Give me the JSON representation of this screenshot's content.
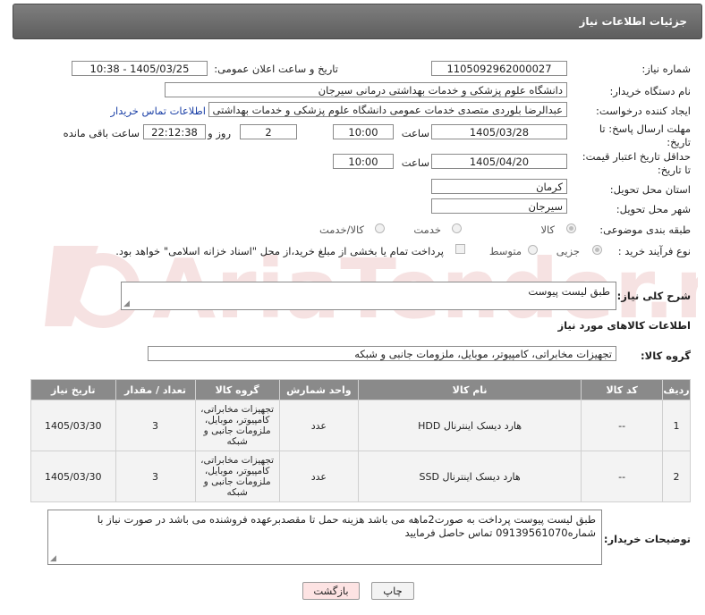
{
  "header": {
    "title": "جزئیات اطلاعات نیاز"
  },
  "form": {
    "need_number_label": "شماره نیاز:",
    "need_number": "1105092962000027",
    "announce_label": "تاریخ و ساعت اعلان عمومی:",
    "announce_value": "1405/03/25 - 10:38",
    "buyer_org_label": "نام دستگاه خریدار:",
    "buyer_org": "دانشگاه علوم پزشکی و خدمات بهداشتی درمانی سیرجان",
    "requester_label": "ایجاد کننده درخواست:",
    "requester": "عبدالرضا بلوردی متصدی خدمات عمومی  دانشگاه علوم پزشکی و خدمات بهداشتی",
    "contact_link": "اطلاعات تماس خریدار",
    "deadline_label_1": "مهلت ارسال پاسخ: تا",
    "deadline_label_2": "تاریخ:",
    "deadline_date": "1405/03/28",
    "hour_label": "ساعت",
    "deadline_time": "10:00",
    "days_value": "2",
    "days_label": "روز و",
    "remaining_time": "22:12:38",
    "remaining_label": "ساعت باقی مانده",
    "validity_label_1": "حداقل تاریخ اعتبار قیمت:",
    "validity_label_2": "تا تاریخ:",
    "validity_date": "1405/04/20",
    "validity_time": "10:00",
    "province_label": "استان محل تحویل:",
    "province": "کرمان",
    "city_label": "شهر محل تحویل:",
    "city": "سیرجان",
    "category_label": "طبقه بندی موضوعی:",
    "category_options": [
      "کالا",
      "خدمت",
      "کالا/خدمت"
    ],
    "category_selected": "کالا",
    "process_label": "نوع فرآیند خرید :",
    "process_options": [
      "جزیی",
      "متوسط"
    ],
    "process_selected": "جزیی",
    "payment_note": "پرداخت تمام یا بخشی از مبلغ خرید،از محل \"اسناد خزانه اسلامی\" خواهد بود."
  },
  "description": {
    "label": "شرح کلی نیاز:",
    "value": "طبق لیست پیوست"
  },
  "goods": {
    "section_title": "اطلاعات کالاهای مورد نیاز",
    "group_label": "گروه کالا:",
    "group_value": "تجهیزات مخابراتی، کامپیوتر، موبایل، ملزومات جانبی و شبکه",
    "columns": [
      "ردیف",
      "کد کالا",
      "نام کالا",
      "واحد شمارش",
      "گروه کالا",
      "تعداد / مقدار",
      "تاریخ نیاز"
    ],
    "rows": [
      {
        "index": "1",
        "code": "--",
        "name": "هارد دیسک اینترنال HDD",
        "unit": "عدد",
        "group": "تجهیزات مخابراتی، کامپیوتر، موبایل، ملزومات جانبی و شبکه",
        "qty": "3",
        "date": "1405/03/30"
      },
      {
        "index": "2",
        "code": "--",
        "name": "هارد دیسک اینترنال SSD",
        "unit": "عدد",
        "group": "تجهیزات مخابراتی، کامپیوتر، موبایل، ملزومات جانبی و شبکه",
        "qty": "3",
        "date": "1405/03/30"
      }
    ]
  },
  "buyer_notes": {
    "label": "توضیحات خریدار:",
    "value": "طبق لیست پیوست پرداخت به صورت2ماهه می باشد هزینه حمل تا مقصدبرعهده فروشنده می باشد در صورت نیاز با شماره09139561070 تماس حاصل فرمایید"
  },
  "buttons": {
    "print": "چاپ",
    "back": "بازگشت"
  },
  "watermark": "AriaTender.neT",
  "colors": {
    "header_bg": "#6e6e6e",
    "table_header_bg": "#8a8a8a",
    "link": "#1a3fa6",
    "back_button_bg": "#fde3e3"
  }
}
